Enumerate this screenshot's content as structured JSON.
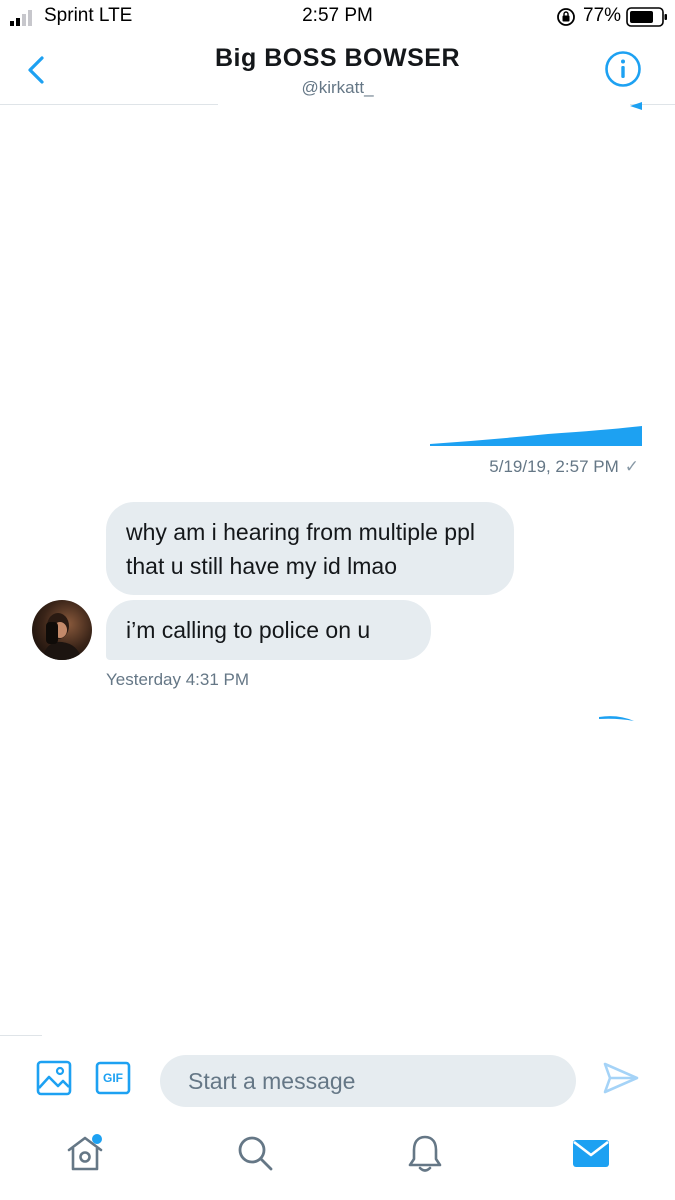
{
  "status_bar": {
    "carrier": "Sprint LTE",
    "time": "2:57 PM",
    "battery": "77%"
  },
  "header": {
    "title": "Big BOSS BOWSER",
    "handle": "@kirkatt_"
  },
  "conversation": {
    "sent_timestamp": "5/19/19, 2:57 PM",
    "sent_status_icon": "check-icon",
    "received_messages": [
      {
        "text": "why am i hearing from multiple ppl that u still have my id lmao"
      },
      {
        "text": "i’m calling to police on u"
      }
    ],
    "received_timestamp": "Yesterday 4:31 PM"
  },
  "composer": {
    "placeholder": "Start a message",
    "gif_label": "GIF"
  },
  "tab_bar": {
    "items": [
      "home-icon",
      "search-icon",
      "notifications-icon",
      "messages-icon"
    ],
    "active": "messages-icon"
  },
  "colors": {
    "accent": "#1da1f2",
    "bubble_received": "#e6ecf0",
    "meta_text": "#657786"
  }
}
